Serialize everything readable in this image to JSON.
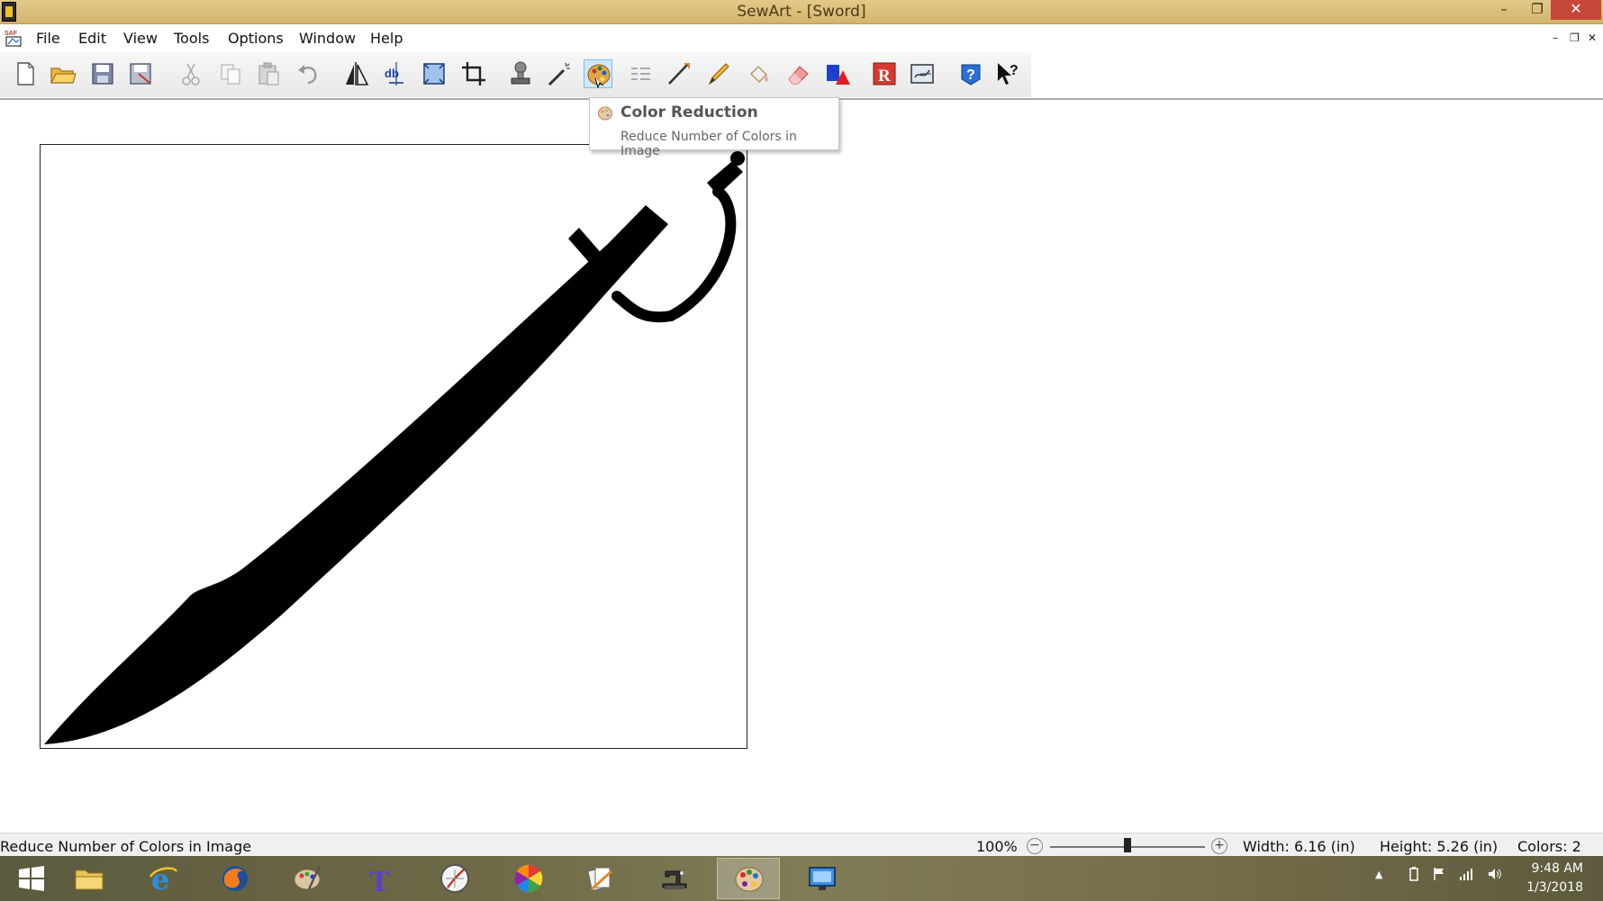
{
  "window": {
    "title": "SewArt - [Sword]",
    "controls": {
      "minimize": "–",
      "maximize": "❐",
      "close": "✕"
    }
  },
  "menu": {
    "items": [
      "File",
      "Edit",
      "View",
      "Tools",
      "Options",
      "Window",
      "Help"
    ],
    "mdi_controls": {
      "minimize": "–",
      "restore": "❐",
      "close": "✕"
    }
  },
  "toolbar": {
    "buttons": [
      "new-file-icon",
      "open-folder-icon",
      "save-icon",
      "save-as-icon",
      "cut-icon",
      "copy-icon",
      "paste-icon",
      "undo-icon",
      "flip-horizontal-icon",
      "flip-vertical-icon",
      "resize-icon",
      "crop-icon",
      "stamp-icon",
      "magic-wand-icon",
      "color-reduction-icon",
      "merge-colors-icon",
      "line-tool-icon",
      "pencil-icon",
      "fill-icon",
      "eraser-icon",
      "shapes-icon",
      "red-r-icon",
      "save-embroidery-icon",
      "help-icon",
      "whats-this-icon"
    ],
    "active_button": "color-reduction-icon"
  },
  "tooltip": {
    "title": "Color Reduction",
    "description": "Reduce Number of Colors in Image"
  },
  "status": {
    "message": "Reduce Number of Colors in Image",
    "zoom": "100%",
    "zoom_level": 0.5,
    "width": "Width: 6.16 (in)",
    "height": "Height: 5.26 (in)",
    "colors": "Colors: 2"
  },
  "taskbar": {
    "apps": [
      "start-icon",
      "file-explorer-icon",
      "internet-explorer-icon",
      "firefox-icon",
      "paint-palette-icon",
      "text-tool-icon",
      "compass-icon",
      "color-wheel-icon",
      "documents-icon",
      "sewing-machine-icon",
      "sewart-icon",
      "display-icon"
    ],
    "active_app": "sewart-icon",
    "time": "9:48 AM",
    "date": "1/3/2018"
  },
  "colors": {
    "title_bar": "#d9bc79",
    "close_button": "#c7473a",
    "active_tool": "#cde8fb",
    "sword": "#000000"
  }
}
